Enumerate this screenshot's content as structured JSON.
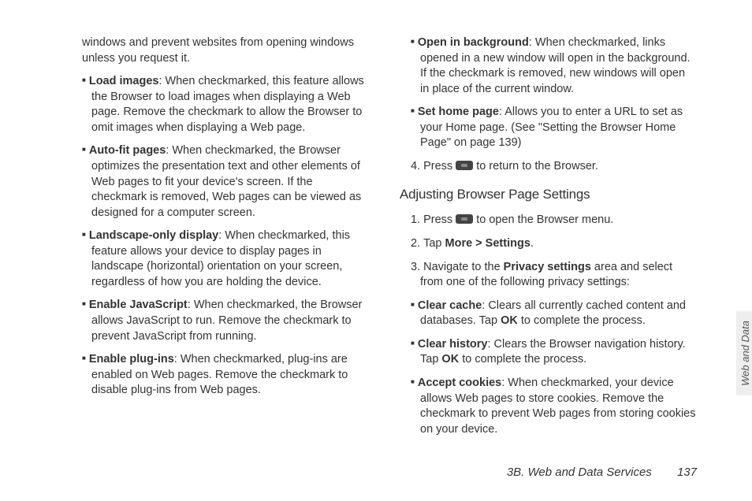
{
  "left": {
    "intro": "windows and prevent websites from opening windows unless you request it.",
    "items": [
      {
        "label": "Load images",
        "text": ": When checkmarked, this feature allows the Browser to load images when displaying a Web page. Remove the checkmark to allow the Browser to omit images when displaying a Web page."
      },
      {
        "label": "Auto-fit pages",
        "text": ": When checkmarked, the Browser optimizes the presentation text and other elements of Web pages to fit your device's screen. If the checkmark is removed, Web pages can be viewed as designed for a computer screen."
      },
      {
        "label": "Landscape-only display",
        "text": ": When checkmarked, this feature allows your device to display pages in landscape (horizontal) orientation on your screen, regardless of how you are holding the device."
      },
      {
        "label": "Enable JavaScript",
        "text": ": When checkmarked, the Browser allows JavaScript to run. Remove the checkmark to prevent JavaScript from running."
      },
      {
        "label": "Enable plug-ins",
        "text": ": When checkmarked, plug-ins are enabled on Web pages. Remove the checkmark to disable plug-ins from Web pages."
      }
    ]
  },
  "right": {
    "top_items": [
      {
        "label": "Open in background",
        "text": ": When checkmarked, links opened in a new window will open in the background. If the checkmark is removed, new windows will open in place of the current window."
      },
      {
        "label": "Set home page",
        "text": ": Allows you to enter a URL to set as your Home page. (See \"Setting the Browser Home Page\" on page 139)"
      }
    ],
    "step4_pre": "Press ",
    "step4_post": " to return to the Browser.",
    "heading": "Adjusting Browser Page Settings",
    "step1_pre": "Press ",
    "step1_post": " to open the Browser menu.",
    "step2_pre": "Tap ",
    "step2_bold": "More > Settings",
    "step2_post": ".",
    "step3_pre": "Navigate to the ",
    "step3_bold": "Privacy settings",
    "step3_post": " area and select from one of the following privacy settings:",
    "sub_items": [
      {
        "label": "Clear cache",
        "text_pre": ": Clears all currently cached content and databases. Tap ",
        "ok": "OK",
        "text_post": " to complete the process."
      },
      {
        "label": "Clear history",
        "text_pre": ": Clears the Browser navigation history. Tap ",
        "ok": "OK",
        "text_post": " to complete the process."
      },
      {
        "label": "Accept cookies",
        "text_pre": ": When checkmarked, your device allows Web pages to store cookies. Remove the checkmark to prevent Web pages from storing cookies on your device.",
        "ok": "",
        "text_post": ""
      }
    ]
  },
  "footer_section": "3B. Web and Data Services",
  "footer_page": "137",
  "side_tab": "Web and Data"
}
